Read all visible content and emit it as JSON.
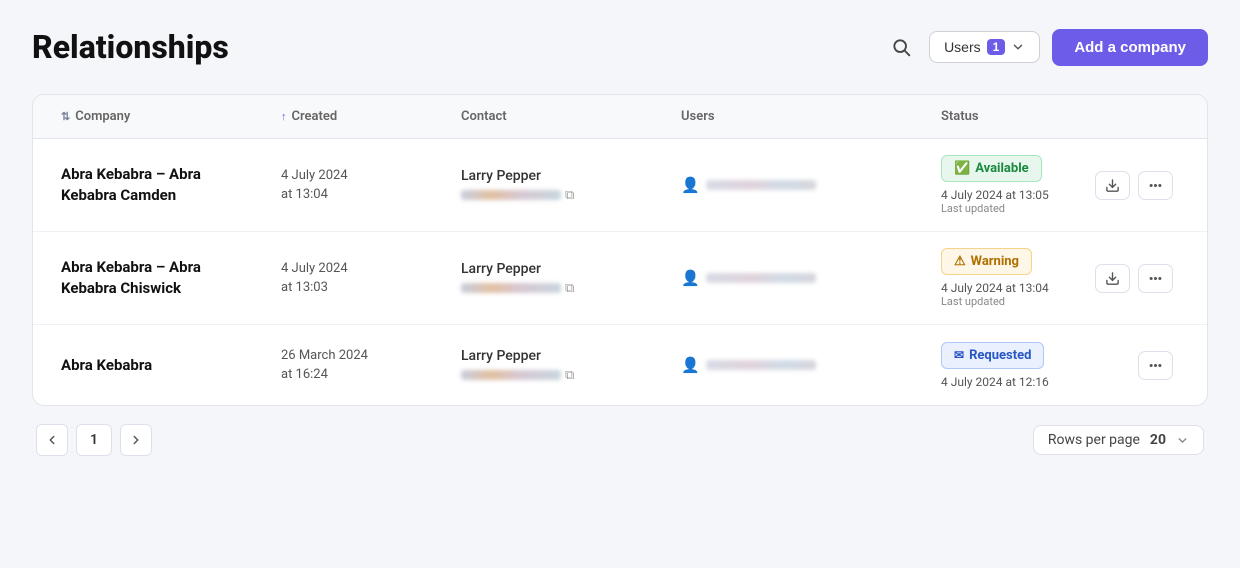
{
  "page": {
    "title": "Relationships"
  },
  "header": {
    "search_label": "Search",
    "filter_label": "Users",
    "filter_count": "1",
    "add_company_label": "Add a company"
  },
  "table": {
    "columns": [
      {
        "id": "company",
        "label": "Company",
        "sort": "both"
      },
      {
        "id": "created",
        "label": "Created",
        "sort": "asc"
      },
      {
        "id": "contact",
        "label": "Contact",
        "sort": "none"
      },
      {
        "id": "users",
        "label": "Users",
        "sort": "none"
      },
      {
        "id": "status",
        "label": "Status",
        "sort": "none"
      }
    ],
    "rows": [
      {
        "company": "Abra Kebabra – Abra Kebabra Camden",
        "created_line1": "4 July 2024",
        "created_line2": "at 13:04",
        "contact_name": "Larry Pepper",
        "status_badge": "Available",
        "status_type": "available",
        "status_date": "4 July 2024 at 13:05",
        "status_meta": "Last updated",
        "has_download": true
      },
      {
        "company": "Abra Kebabra – Abra Kebabra Chiswick",
        "created_line1": "4 July 2024",
        "created_line2": "at 13:03",
        "contact_name": "Larry Pepper",
        "status_badge": "Warning",
        "status_type": "warning",
        "status_date": "4 July 2024 at 13:04",
        "status_meta": "Last updated",
        "has_download": true
      },
      {
        "company": "Abra Kebabra",
        "created_line1": "26 March 2024",
        "created_line2": "at 16:24",
        "contact_name": "Larry Pepper",
        "status_badge": "Requested",
        "status_type": "requested",
        "status_date": "4 July 2024 at 12:16",
        "status_meta": "",
        "has_download": false
      }
    ]
  },
  "footer": {
    "page_current": "1",
    "rows_per_page_label": "Rows per page",
    "rows_per_page_value": "20"
  }
}
